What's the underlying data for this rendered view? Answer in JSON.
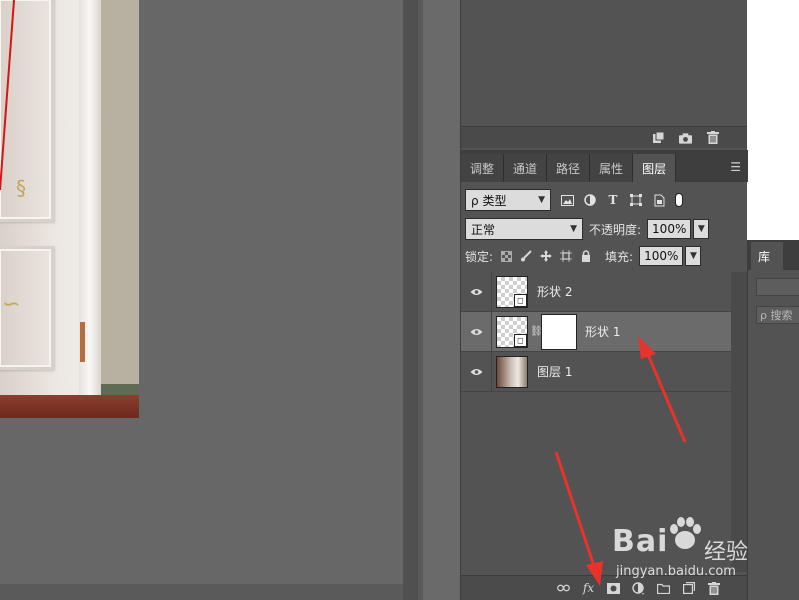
{
  "upper_panel": {
    "footer_icons": [
      "new-snapshot-icon",
      "camera-icon",
      "trash-icon"
    ]
  },
  "layers_panel": {
    "tabs": [
      {
        "label": "调整"
      },
      {
        "label": "通道"
      },
      {
        "label": "路径"
      },
      {
        "label": "属性"
      },
      {
        "label": "图层"
      }
    ],
    "active_tab": "图层",
    "filter": {
      "search_symbol": "ρ",
      "kind_label": "类型"
    },
    "blend_mode": "正常",
    "opacity_label": "不透明度:",
    "opacity_value": "100%",
    "lock_label": "锁定:",
    "fill_label": "填充:",
    "fill_value": "100%",
    "layers": [
      {
        "name": "形状 2",
        "visible": true,
        "selected": false,
        "type": "shape"
      },
      {
        "name": "形状 1",
        "visible": true,
        "selected": true,
        "type": "shape-with-mask"
      },
      {
        "name": "图层 1",
        "visible": true,
        "selected": false,
        "type": "pixel"
      }
    ],
    "footer_icons": [
      "link-layers-icon",
      "fx-icon",
      "add-mask-icon",
      "adjustment-layer-icon",
      "folder-icon",
      "new-layer-icon",
      "trash-icon"
    ],
    "fx_label": "fx"
  },
  "library_panel": {
    "tab_label": "库",
    "search_placeholder": "ρ 搜索"
  },
  "watermark": {
    "brand": "Bai",
    "brand_suffix": "经验",
    "url": "jingyan.baidu.com"
  },
  "colors": {
    "annotation_arrow": "#e8322b",
    "panel_bg": "#535353",
    "selected_row": "#6b6b6b"
  }
}
